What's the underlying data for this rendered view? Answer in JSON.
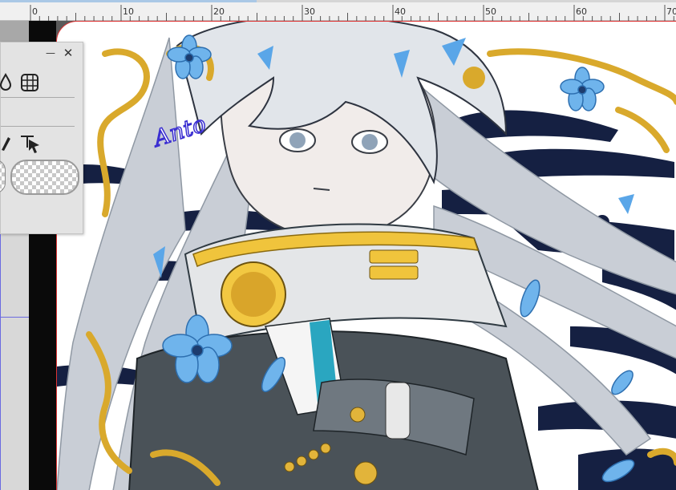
{
  "ruler": {
    "unit_labels": [
      "0",
      "10",
      "20",
      "30",
      "40",
      "50",
      "60",
      "70"
    ]
  },
  "panel": {
    "minimize_label": "—",
    "close_label": "✕",
    "icons": {
      "row1": [
        "drop-icon",
        "grid-transform-icon"
      ],
      "row2": [
        "pen-icon",
        "select-arrow-icon"
      ]
    }
  },
  "canvas": {
    "signature_text": "Anto",
    "colors": {
      "hair": "#d9dde3",
      "accent_blue": "#5aa6e8",
      "gold": "#e2b43a",
      "jacket": "#4a5258",
      "dark_navy": "#152042"
    }
  }
}
